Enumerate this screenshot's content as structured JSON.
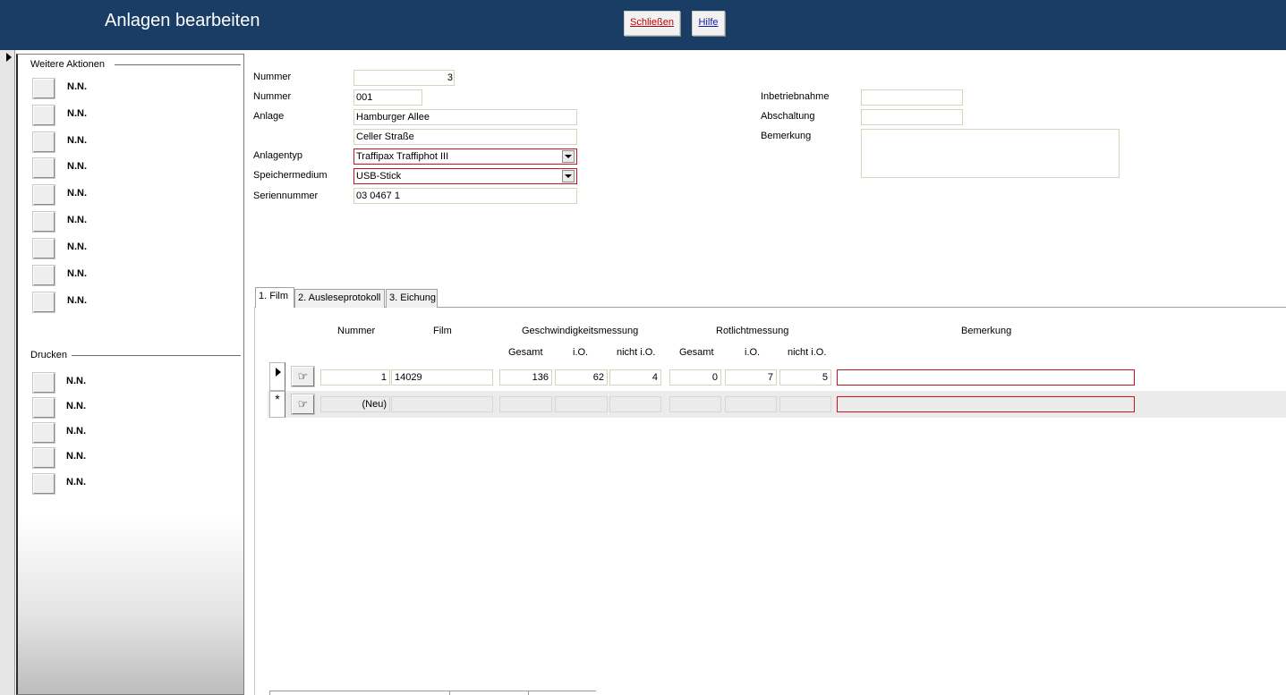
{
  "header": {
    "title": "Anlagen bearbeiten",
    "close_label": "Schließen",
    "help_label": "Hilfe"
  },
  "sidebar": {
    "actions_title": "Weitere Aktionen",
    "actions": [
      "N.N.",
      "N.N.",
      "N.N.",
      "N.N.",
      "N.N.",
      "N.N.",
      "N.N.",
      "N.N.",
      "N.N."
    ],
    "print_title": "Drucken",
    "print_items": [
      "N.N.",
      "N.N.",
      "N.N.",
      "N.N.",
      "N.N."
    ]
  },
  "form": {
    "nummer_top": {
      "label": "Nummer",
      "value": "3"
    },
    "nummer": {
      "label": "Nummer",
      "value": "001"
    },
    "anlage": {
      "label": "Anlage",
      "value1": "Hamburger Allee",
      "value2": "Celler Straße"
    },
    "anlagentyp": {
      "label": "Anlagentyp",
      "value": "Traffipax Traffiphot III"
    },
    "speichermedium": {
      "label": "Speichermedium",
      "value": "USB-Stick"
    },
    "seriennummer": {
      "label": "Seriennummer",
      "value": "03 0467 1"
    },
    "inbetriebnahme": {
      "label": "Inbetriebnahme",
      "value": ""
    },
    "abschaltung": {
      "label": "Abschaltung",
      "value": ""
    },
    "bemerkung": {
      "label": "Bemerkung",
      "value": ""
    }
  },
  "tabs": [
    {
      "label": "1. Film",
      "active": true
    },
    {
      "label": "2. Ausleseprotokoll",
      "active": false
    },
    {
      "label": "3. Eichung",
      "active": false
    }
  ],
  "grid": {
    "headers": {
      "nummer": "Nummer",
      "film": "Film",
      "geschwindigkeit": "Geschwindigkeitsmessung",
      "rotlicht": "Rotlichtmessung",
      "bemerkung": "Bemerkung",
      "g_gesamt": "Gesamt",
      "g_io": "i.O.",
      "g_nicht_io": "nicht i.O.",
      "r_gesamt": "Gesamt",
      "r_io": "i.O.",
      "r_nicht_io": "nicht i.O."
    },
    "rows": [
      {
        "nummer": "1",
        "film": "14029",
        "g_gesamt": "136",
        "g_io": "62",
        "g_nicht_io": "4",
        "r_gesamt": "0",
        "r_io": "7",
        "r_nicht_io": "5",
        "bemerkung": ""
      }
    ],
    "new_row": {
      "nummer": "(Neu)"
    }
  },
  "icons": {
    "record_selector": "triangle-right",
    "new_record": "asterisk",
    "row_button": "hand-pointer-icon"
  }
}
